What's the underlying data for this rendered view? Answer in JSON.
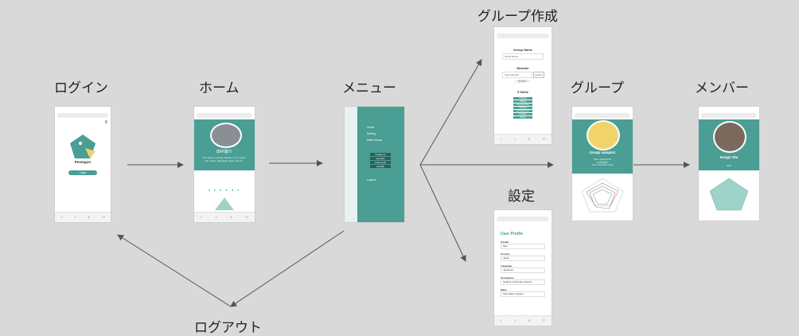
{
  "labels": {
    "login": "ログイン",
    "home": "ホーム",
    "menu": "メニュー",
    "group_create": "グループ作成",
    "group": "グループ",
    "members": "メンバー",
    "settings": "設定",
    "logout": "ログアウト"
  },
  "colors": {
    "accent": "#4a9e94",
    "background": "#d9d9d9",
    "arrow": "#555555"
  },
  "login_screen": {
    "logo_text": "Pentagon",
    "button": "Login"
  },
  "home_screen": {
    "user_name": "田中康介",
    "bio": "My name is kosuke tanaka. I'm 21 years old. hobby...Baseball, Music, Movie..."
  },
  "menu_screen": {
    "items": [
      "Home",
      "Setting",
      "Make Group"
    ],
    "groups": [
      "Kadgroup",
      "sample1",
      "Adult gods",
      "Haisaki"
    ],
    "logout": "Logout"
  },
  "group_create_screen": {
    "group_name_label": "Group Name",
    "group_name_placeholder": "Group Name",
    "member_label": "Member",
    "member_placeholder": "Type Member",
    "member_button": "Confirm",
    "member_value": "[ \"田中康介\" ]",
    "skills_label": "5 Skills",
    "skills": [
      "Cooking",
      "Talking",
      "Programming",
      "Science",
      "Entertainment",
      "Fashion",
      "Sports"
    ]
  },
  "settings_screen": {
    "title": "User Profile",
    "fields": [
      {
        "label": "Gender",
        "value": "Men"
      },
      {
        "label": "Country",
        "value": "Japan"
      },
      {
        "label": "Language",
        "value": "Japanese"
      },
      {
        "label": "Occupation",
        "value": "Student (university student)"
      },
      {
        "label": "Major",
        "value": "Information System"
      }
    ]
  },
  "group_screen": {
    "title": "Group sample1",
    "date": "Since 2019/10/19",
    "owner": "by 田中康介",
    "description": "This is Sample Group"
  },
  "member_screen": {
    "name": "Kengo Ota",
    "subtitle": "hello"
  }
}
